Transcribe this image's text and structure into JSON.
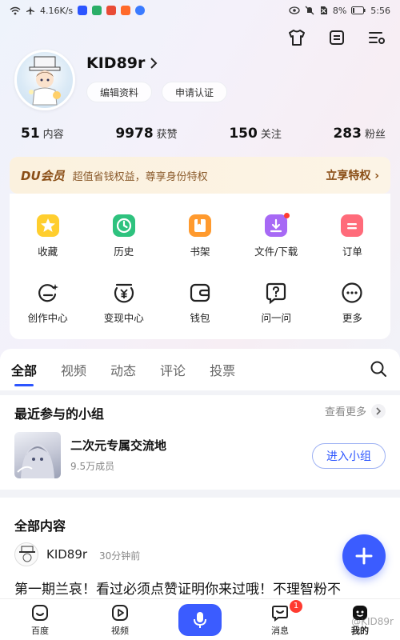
{
  "status_bar": {
    "speed": "4.16K/s",
    "battery": "8%",
    "time": "5:56"
  },
  "profile": {
    "username": "KID89r",
    "edit_label": "编辑资料",
    "verify_label": "申请认证"
  },
  "stats": [
    {
      "num": "51",
      "label": "内容"
    },
    {
      "num": "9978",
      "label": "获赞"
    },
    {
      "num": "150",
      "label": "关注"
    },
    {
      "num": "283",
      "label": "粉丝"
    }
  ],
  "vip": {
    "title": "DU会员",
    "desc": "超值省钱权益，尊享身份特权",
    "cta": "立享特权 ›"
  },
  "grid": {
    "row1": [
      "收藏",
      "历史",
      "书架",
      "文件/下载",
      "订单"
    ],
    "row2": [
      "创作中心",
      "变现中心",
      "钱包",
      "问一问",
      "更多"
    ]
  },
  "tabs": [
    "全部",
    "视频",
    "动态",
    "评论",
    "投票"
  ],
  "groups": {
    "title": "最近参与的小组",
    "more": "查看更多",
    "name": "二次元专属交流地",
    "members": "9.5万成员",
    "join_label": "进入小组"
  },
  "content": {
    "title": "全部内容",
    "author": "KID89r",
    "time": "30分钟前",
    "text": "第一期兰哀！看过必须点赞证明你来过哦！不理智粉不"
  },
  "bottom_nav": {
    "home": "百度",
    "video": "视频",
    "messages": "消息",
    "messages_badge": "1",
    "me": "我的"
  },
  "watermark": "@KID89r",
  "colors": {
    "accent": "#3b5cff",
    "vip_text": "#8a4e16",
    "badge": "#ff3b30"
  }
}
